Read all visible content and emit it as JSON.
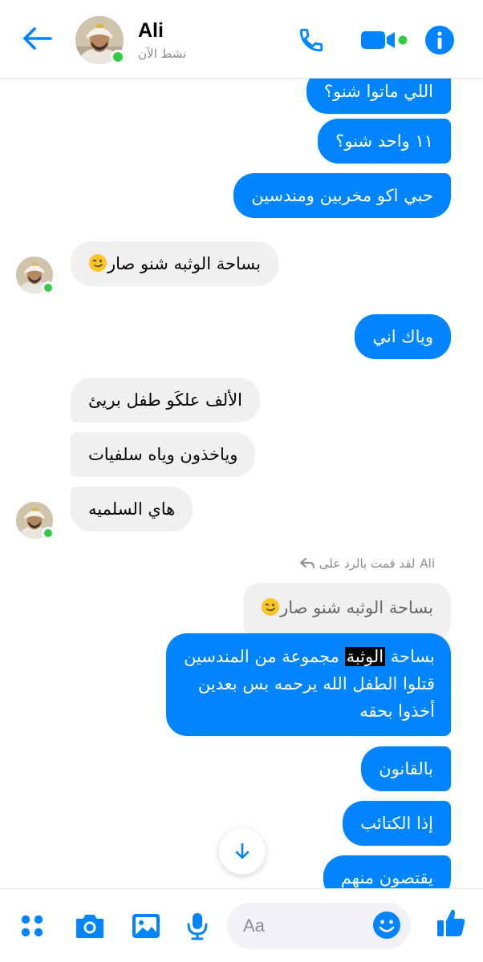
{
  "header": {
    "contact_name": "Ali",
    "status": "نشط الآن"
  },
  "messages": [
    {
      "dir": "out",
      "text": "اللي ماتوا شنو؟"
    },
    {
      "dir": "out",
      "text": "١١ واحد شنو؟"
    },
    {
      "dir": "out",
      "text": "حبي اكو مخربين ومندسين"
    },
    {
      "dir": "in",
      "text": "بساحة الوثبه شنو صار",
      "emoji": "winking-face"
    },
    {
      "dir": "out",
      "text": "وياك اني"
    },
    {
      "dir": "in",
      "text": "الألف علكَو طفل بريئ"
    },
    {
      "dir": "in",
      "text": "وياخذون وياه سلفيات"
    },
    {
      "dir": "in",
      "text": "هاي السلميه"
    },
    {
      "dir": "out",
      "text": "بالقانون"
    },
    {
      "dir": "out",
      "text": "إذا الكتائب"
    },
    {
      "dir": "out",
      "text": "يقتصون منهم"
    }
  ],
  "reply": {
    "label": "لقد قمت بالرد على",
    "label_name": "Ali",
    "quoted_text": "بساحة الوثبه شنو صار",
    "quoted_emoji": "winking-face",
    "line1_before": "بساحة ",
    "line1_highlight": "الوثبة",
    "line1_after": " مجموعة من المندسين",
    "line2": "قتلوا الطفل الله يرحمه بس بعدين",
    "line3": "أخذوا بحقه"
  },
  "composer": {
    "placeholder": "Aa",
    "icons": [
      "apps-icon",
      "camera-icon",
      "gallery-icon",
      "microphone-icon",
      "emoji-icon",
      "thumbs-up-icon"
    ]
  },
  "colors": {
    "accent": "#0084ff",
    "incoming_bubble": "#f0f0f0",
    "online": "#31cc46"
  }
}
